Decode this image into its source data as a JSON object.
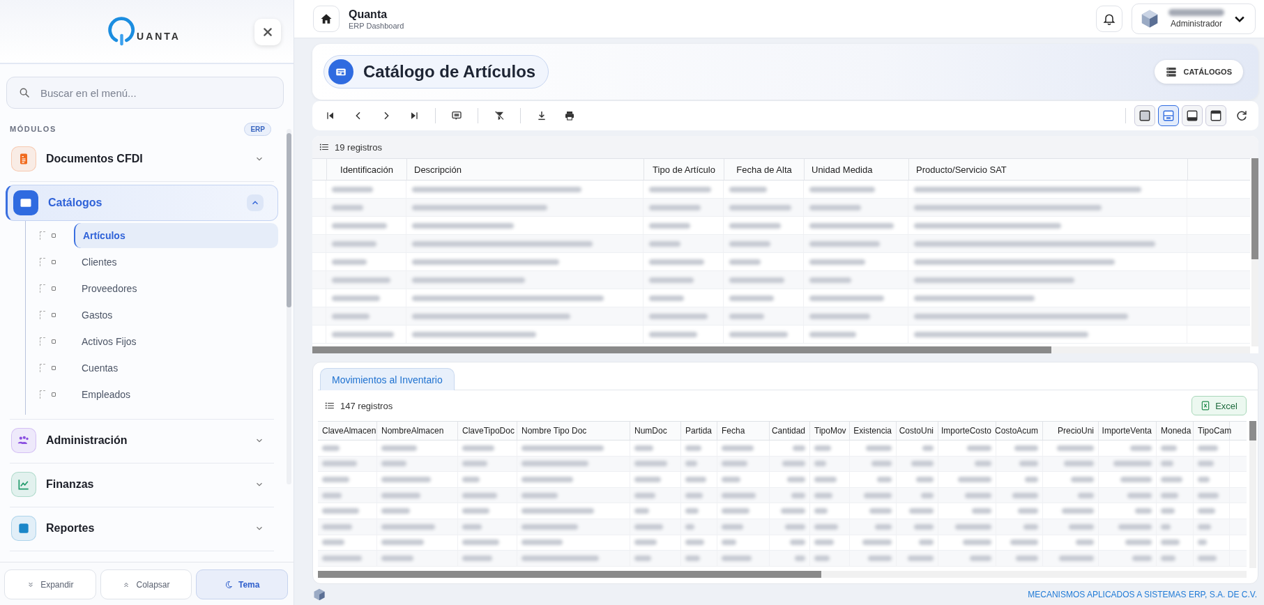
{
  "sidebar": {
    "logo": "UANTA",
    "search": {
      "placeholder": "Buscar en el menú..."
    },
    "section_label": "MÓDULOS",
    "section_badge": "ERP",
    "modules": [
      {
        "label": "Documentos CFDI",
        "color": "#f06a1d",
        "expanded": false,
        "selected": false
      },
      {
        "label": "Catálogos",
        "color": "#2f6be0",
        "expanded": true,
        "selected": true,
        "children": [
          {
            "label": "Artículos",
            "selected": true
          },
          {
            "label": "Clientes",
            "selected": false
          },
          {
            "label": "Proveedores",
            "selected": false
          },
          {
            "label": "Gastos",
            "selected": false
          },
          {
            "label": "Activos Fijos",
            "selected": false
          },
          {
            "label": "Cuentas",
            "selected": false
          },
          {
            "label": "Empleados",
            "selected": false
          }
        ]
      },
      {
        "label": "Administración",
        "color": "#8a4fe0",
        "expanded": false,
        "selected": false
      },
      {
        "label": "Finanzas",
        "color": "#1f9a6a",
        "expanded": false,
        "selected": false
      },
      {
        "label": "Reportes",
        "color": "#1a86c8",
        "expanded": false,
        "selected": false
      }
    ],
    "footer_buttons": [
      {
        "label": "Expandir",
        "selected": false
      },
      {
        "label": "Colapsar",
        "selected": false
      },
      {
        "label": "Tema",
        "selected": true
      }
    ]
  },
  "header": {
    "title": "Quanta",
    "subtitle": "ERP Dashboard",
    "user": {
      "name": {
        "kind": "blurred"
      },
      "role": "Administrador"
    }
  },
  "page": {
    "title": "Catálogo de Artículos",
    "catalogs_button": "CATÁLOGOS",
    "layout_options": [
      {
        "selected": false
      },
      {
        "selected": true
      },
      {
        "selected": false
      },
      {
        "selected": false
      }
    ]
  },
  "main_table": {
    "count": "19 registros",
    "columns": [
      "Identificación",
      "Descripción",
      "Tipo de Artículo",
      "Fecha de Alta",
      "Unidad Medida",
      "Producto/Servicio SAT"
    ],
    "rows": [
      {
        "kind": "blurred"
      },
      {
        "kind": "blurred"
      },
      {
        "kind": "blurred"
      },
      {
        "kind": "blurred"
      },
      {
        "kind": "blurred"
      },
      {
        "kind": "blurred"
      },
      {
        "kind": "blurred"
      },
      {
        "kind": "blurred"
      },
      {
        "kind": "blurred"
      }
    ]
  },
  "detail": {
    "tabs": [
      {
        "label": "Movimientos al Inventario",
        "selected": true
      }
    ],
    "count": "147 registros",
    "excel_button": "Excel",
    "columns": [
      "ClaveAlmacen",
      "NombreAlmacen",
      "ClaveTipoDoc",
      "Nombre Tipo Doc",
      "NumDoc",
      "Partida",
      "Fecha",
      "Cantidad",
      "TipoMov",
      "Existencia",
      "CostoUni",
      "ImporteCosto",
      "CostoAcum",
      "PrecioUni",
      "ImporteVenta",
      "Moneda",
      "TipoCam"
    ],
    "rows": [
      {
        "kind": "blurred"
      },
      {
        "kind": "blurred"
      },
      {
        "kind": "blurred"
      },
      {
        "kind": "blurred"
      },
      {
        "kind": "blurred"
      },
      {
        "kind": "blurred"
      },
      {
        "kind": "blurred"
      },
      {
        "kind": "blurred"
      }
    ]
  },
  "footer": {
    "company": "MECANISMOS APLICADOS A SISTEMAS ERP, S.A. DE C.V."
  }
}
